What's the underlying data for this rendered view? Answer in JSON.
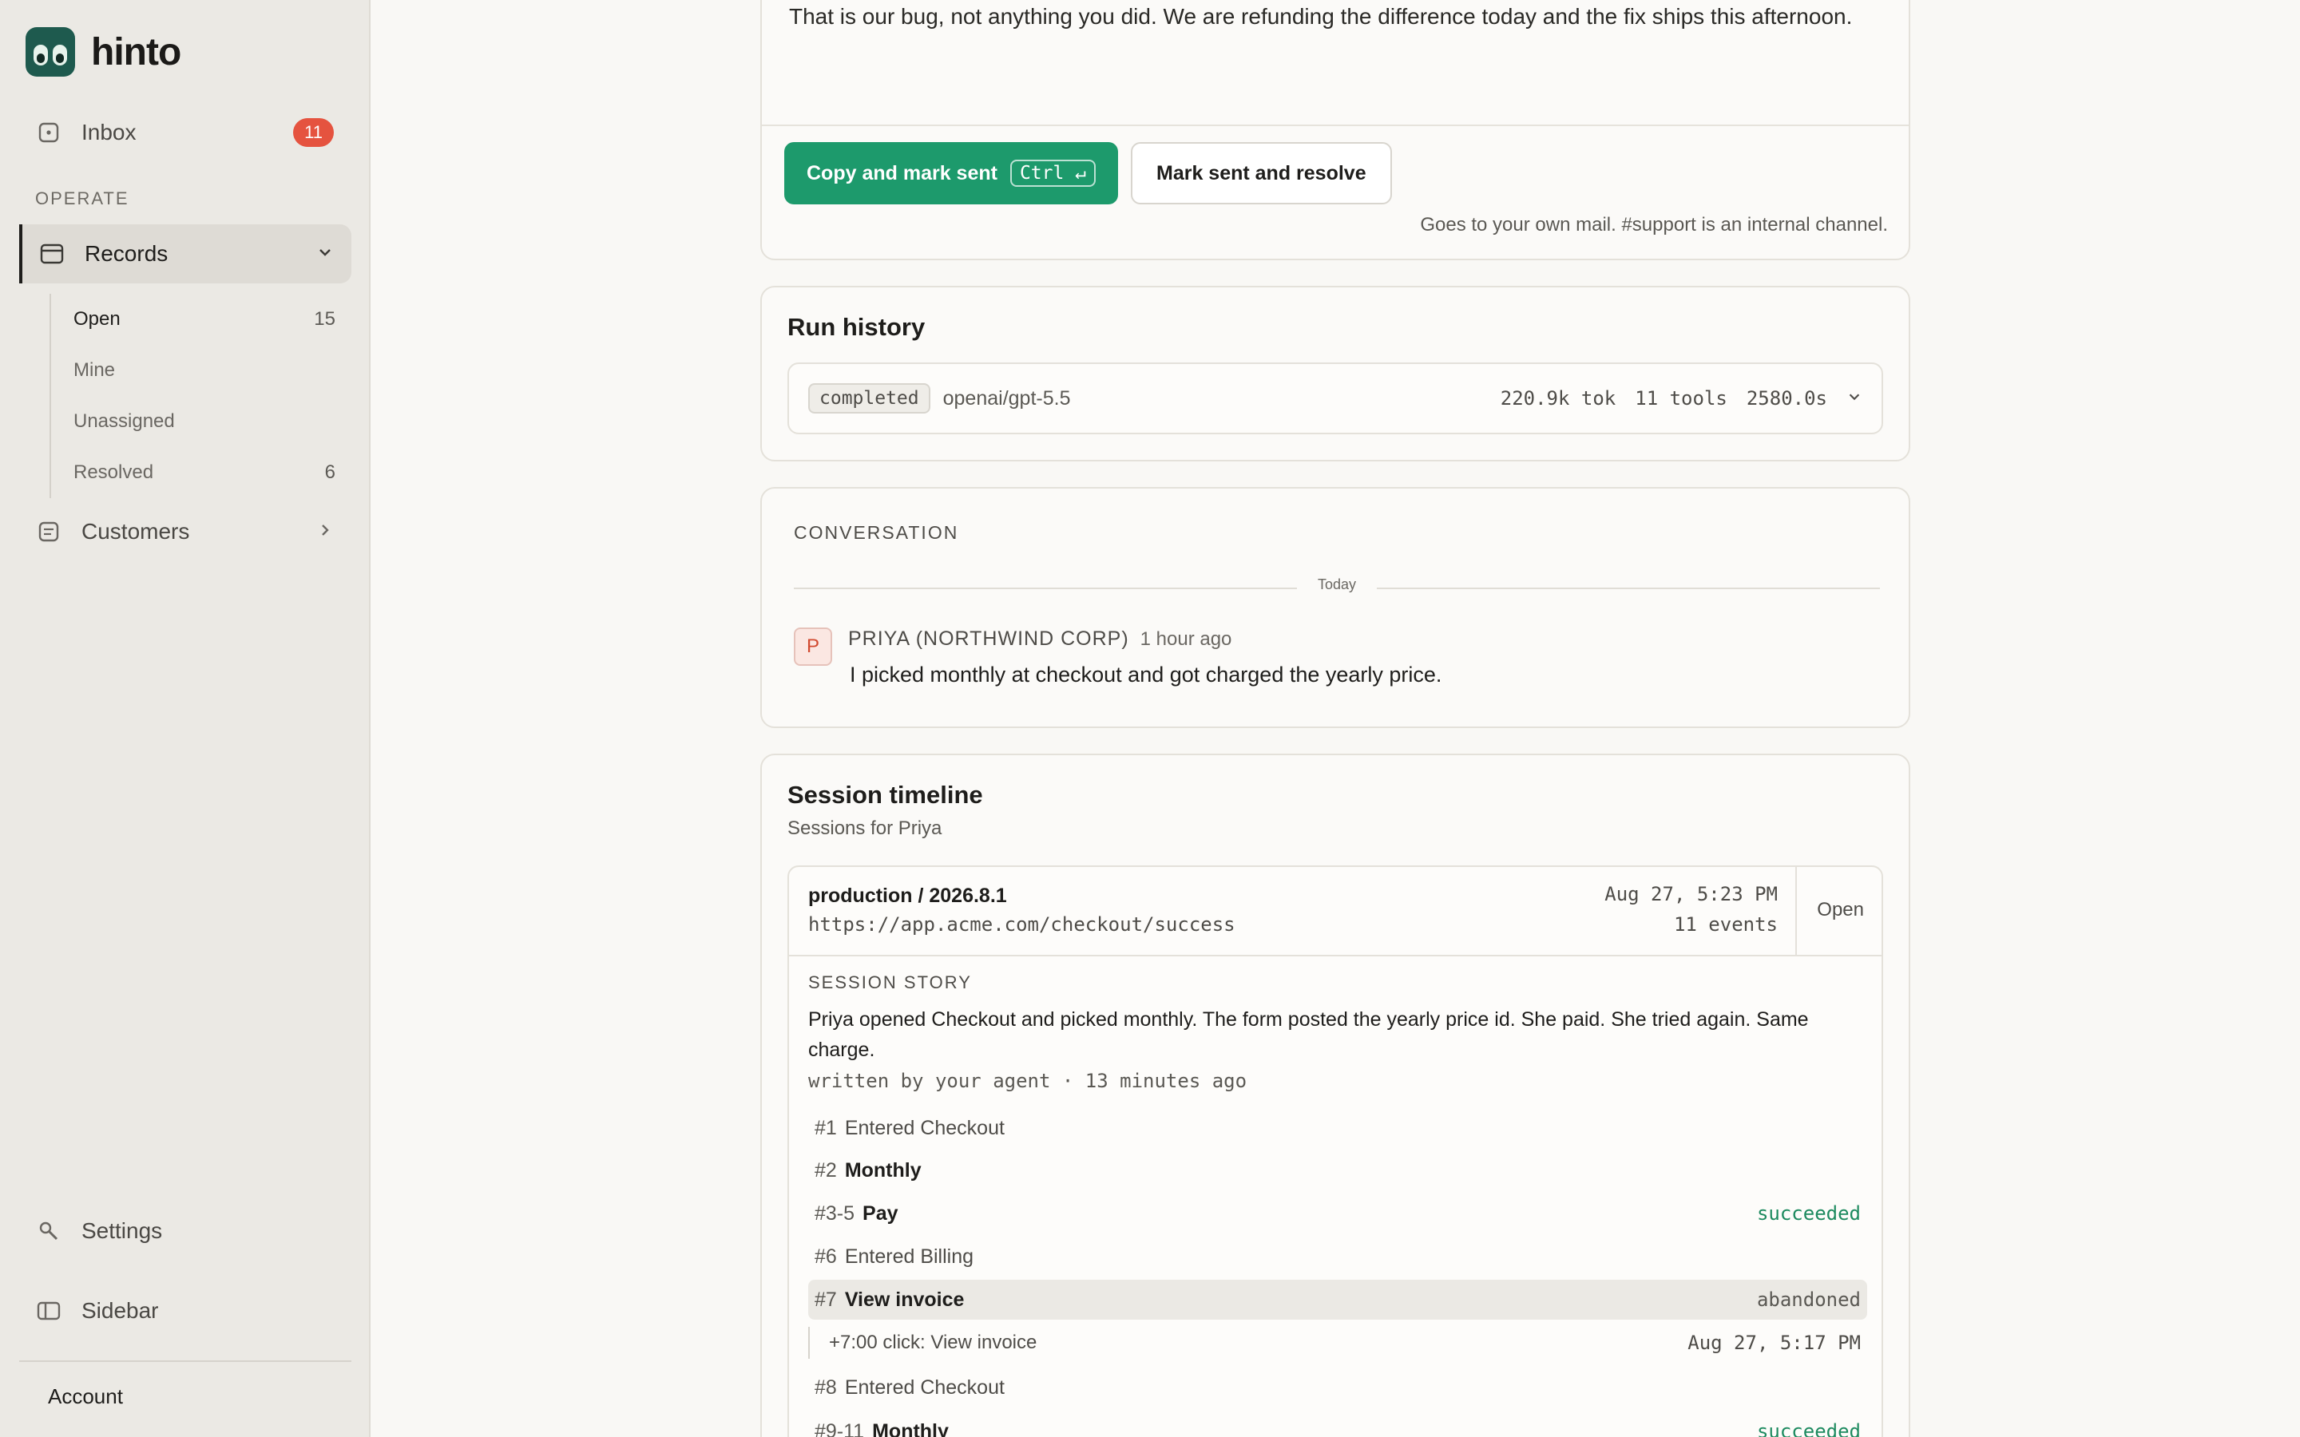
{
  "app": {
    "name": "hinto"
  },
  "sidebar": {
    "inbox": {
      "label": "Inbox",
      "badge": "11"
    },
    "section": "OPERATE",
    "records": {
      "label": "Records",
      "items": [
        {
          "label": "Open",
          "count": "15"
        },
        {
          "label": "Mine",
          "count": ""
        },
        {
          "label": "Unassigned",
          "count": ""
        },
        {
          "label": "Resolved",
          "count": "6"
        }
      ]
    },
    "customers": {
      "label": "Customers"
    },
    "settings": {
      "label": "Settings"
    },
    "toggle": {
      "label": "Sidebar"
    },
    "account": {
      "label": "Account"
    }
  },
  "reply": {
    "text": "That is our bug, not anything you did. We are refunding the difference today and the fix ships this afternoon.",
    "primary_label": "Copy and mark sent",
    "primary_shortcut": "Ctrl ↵",
    "secondary_label": "Mark sent and resolve",
    "hint": "Goes to your own mail. #support is an internal channel."
  },
  "run_history": {
    "title": "Run history",
    "status": "completed",
    "model": "openai/gpt-5.5",
    "tokens": "220.9k tok",
    "tools": "11 tools",
    "duration": "2580.0s"
  },
  "conversation": {
    "label": "CONVERSATION",
    "divider": "Today",
    "avatar": "P",
    "author": "PRIYA (NORTHWIND CORP)",
    "time": "1 hour ago",
    "message": "I picked monthly at checkout and got charged the yearly price."
  },
  "session": {
    "title": "Session timeline",
    "subtitle": "Sessions for Priya",
    "env": "production / 2026.8.1",
    "url": "https://app.acme.com/checkout/success",
    "date": "Aug 27, 5:23 PM",
    "events_count": "11 events",
    "open_label": "Open",
    "story_label": "SESSION STORY",
    "story": "Priya opened Checkout and picked monthly. The form posted the yearly price id. She paid. She tried again. Same charge.",
    "story_meta": "written by your agent · 13 minutes ago",
    "events": [
      {
        "num": "#1",
        "label": "Entered Checkout",
        "status": ""
      },
      {
        "num": "#2",
        "label": "Monthly",
        "status": ""
      },
      {
        "num": "#3-5",
        "label": "Pay",
        "status": "succeeded"
      },
      {
        "num": "#6",
        "label": "Entered Billing",
        "status": ""
      },
      {
        "num": "#7",
        "label": "View invoice",
        "status": "abandoned"
      },
      {
        "num": "#8",
        "label": "Entered Checkout",
        "status": ""
      },
      {
        "num": "#9-11",
        "label": "Monthly",
        "status": "succeeded"
      }
    ],
    "detail": {
      "text": "+7:00 click: View invoice",
      "when": "Aug 27, 5:17 PM"
    }
  }
}
